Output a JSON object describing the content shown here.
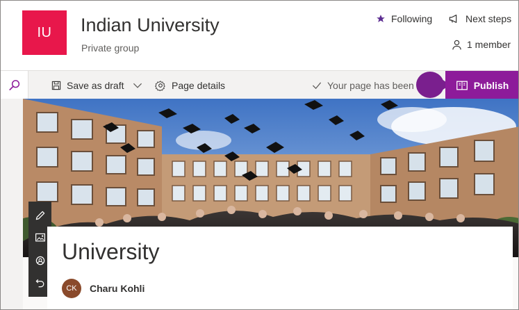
{
  "site": {
    "logo_text": "IU",
    "logo_color": "#e8174b",
    "title": "Indian University",
    "subtitle": "Private group"
  },
  "header_actions": {
    "following": "Following",
    "next_steps": "Next steps",
    "members": "1 member"
  },
  "command_bar": {
    "save_as_draft": "Save as draft",
    "page_details": "Page details",
    "status": "Your page has been s",
    "publish": "Publish",
    "publish_color": "#8d1b9a"
  },
  "toolbox": {
    "icons": [
      "edit-icon",
      "image-edit-icon",
      "focal-point-icon",
      "reset-icon"
    ]
  },
  "page": {
    "title": "University",
    "author_initials": "CK",
    "author_name": "Charu Kohli"
  }
}
